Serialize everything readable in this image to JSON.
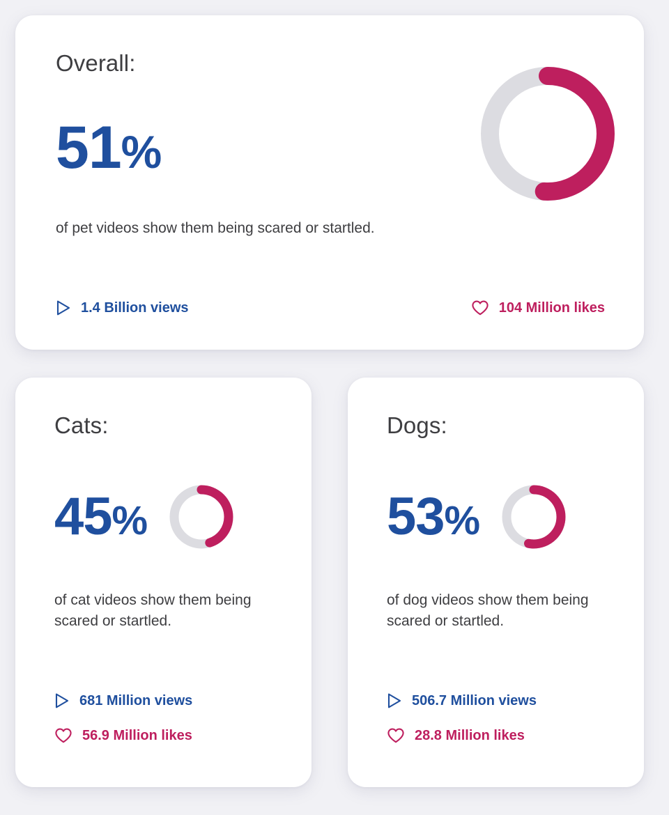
{
  "theme": {
    "page_background": "#f1f1f5",
    "card_background": "#ffffff",
    "blue": "#1f4f9e",
    "crimson": "#be1f5e",
    "track_gray": "#dcdce1",
    "heading_gray": "#3e3e41"
  },
  "cards": {
    "overall": {
      "title": "Overall:",
      "percent_number": "51",
      "percent_symbol": "%",
      "percent_value": 51,
      "description": "of pet videos show them being scared or startled.",
      "views_label": "1.4 Billion views",
      "likes_label": "104 Million likes",
      "views_icon": "play-icon",
      "likes_icon": "heart-icon"
    },
    "cats": {
      "title": "Cats:",
      "percent_number": "45",
      "percent_symbol": "%",
      "percent_value": 45,
      "description": "of cat videos show them being scared or startled.",
      "views_label": "681 Million views",
      "likes_label": "56.9 Million likes",
      "views_icon": "play-icon",
      "likes_icon": "heart-icon"
    },
    "dogs": {
      "title": "Dogs:",
      "percent_number": "53",
      "percent_symbol": "%",
      "percent_value": 53,
      "description": "of dog videos show them being scared or startled.",
      "views_label": "506.7 Million views",
      "likes_label": "28.8 Million likes",
      "views_icon": "play-icon",
      "likes_icon": "heart-icon"
    }
  },
  "chart_data": [
    {
      "type": "pie",
      "title": "Overall",
      "subtitle": "of pet videos show them being scared or startled.",
      "labels": [
        "scared or startled",
        "remainder"
      ],
      "values": [
        51,
        49
      ],
      "colors": [
        "#be1f5e",
        "#dcdce1"
      ],
      "display_value": "51%",
      "start_angle_deg": 0,
      "direction": "clockwise",
      "legend": "none"
    },
    {
      "type": "pie",
      "title": "Cats",
      "subtitle": "of cat videos show them being scared or startled.",
      "labels": [
        "scared or startled",
        "remainder"
      ],
      "values": [
        45,
        55
      ],
      "colors": [
        "#be1f5e",
        "#dcdce1"
      ],
      "display_value": "45%",
      "start_angle_deg": 0,
      "direction": "clockwise",
      "legend": "none"
    },
    {
      "type": "pie",
      "title": "Dogs",
      "subtitle": "of dog videos show them being scared or startled.",
      "labels": [
        "scared or startled",
        "remainder"
      ],
      "values": [
        53,
        47
      ],
      "colors": [
        "#be1f5e",
        "#dcdce1"
      ],
      "display_value": "53%",
      "start_angle_deg": 0,
      "direction": "clockwise",
      "legend": "none"
    }
  ]
}
